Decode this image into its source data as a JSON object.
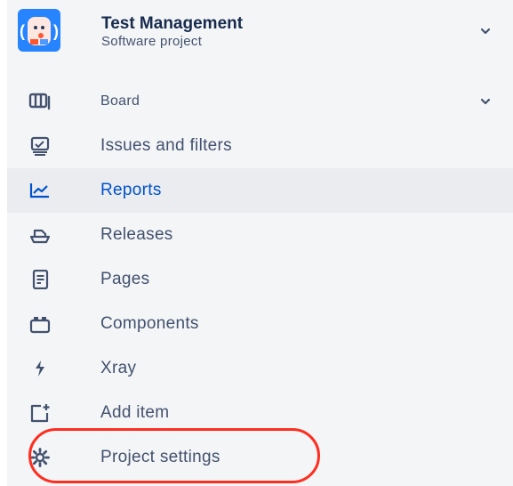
{
  "project": {
    "title": "Test Management",
    "subtitle": "Software project"
  },
  "nav": {
    "items": [
      {
        "label": "Board",
        "icon": "board-icon"
      },
      {
        "label": "Issues and filters",
        "icon": "issues-icon"
      },
      {
        "label": "Reports",
        "icon": "reports-icon"
      },
      {
        "label": "Releases",
        "icon": "releases-icon"
      },
      {
        "label": "Pages",
        "icon": "pages-icon"
      },
      {
        "label": "Components",
        "icon": "components-icon"
      },
      {
        "label": "Xray",
        "icon": "xray-icon"
      },
      {
        "label": "Add item",
        "icon": "add-item-icon"
      },
      {
        "label": "Project settings",
        "icon": "gear-icon"
      }
    ],
    "active": "Reports"
  },
  "colors": {
    "active_text": "#0052cc",
    "highlight_ring": "#ff2d1f",
    "sidebar_bg": "#f4f5f7"
  }
}
